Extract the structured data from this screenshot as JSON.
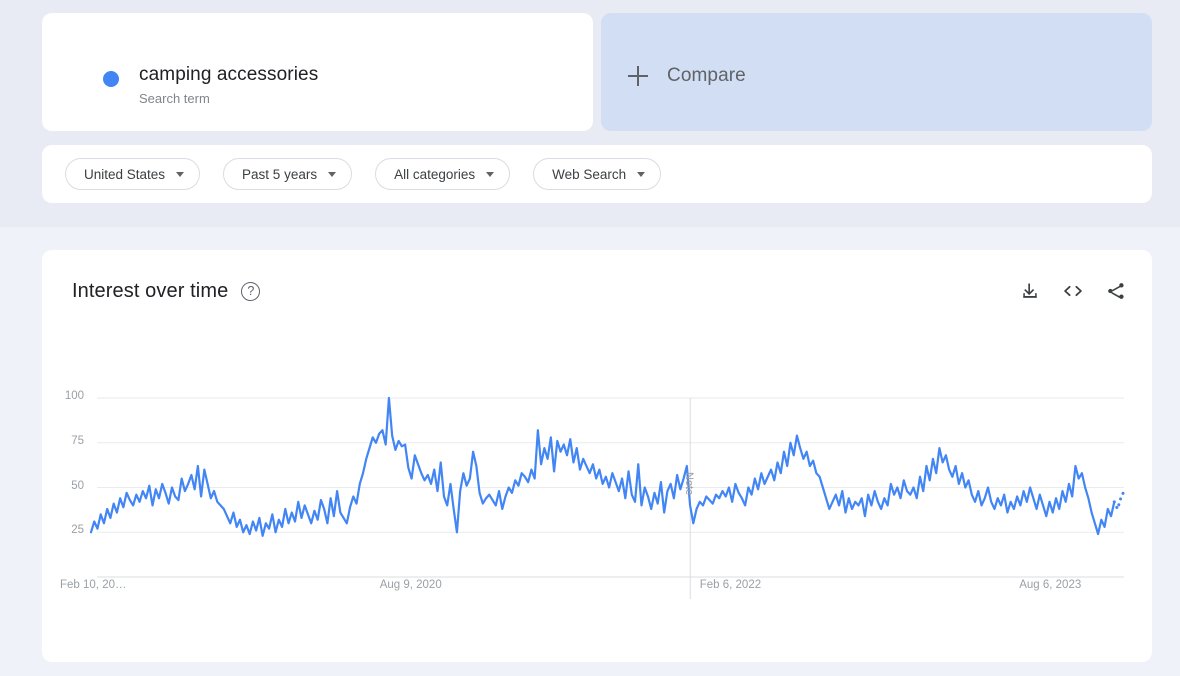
{
  "page": {
    "background_top": "#e8ebf4",
    "background_bottom": "#eff2f9",
    "accent_color": "#4285f4"
  },
  "term_card": {
    "title": "camping accessories",
    "subtitle": "Search term",
    "dot_color": "#4285f4",
    "menu_icon": "kebab-menu-icon"
  },
  "compare_card": {
    "label": "Compare",
    "icon": "plus-icon"
  },
  "filters": [
    {
      "label": "United States",
      "icon": "chevron-down-icon"
    },
    {
      "label": "Past 5 years",
      "icon": "chevron-down-icon"
    },
    {
      "label": "All categories",
      "icon": "chevron-down-icon"
    },
    {
      "label": "Web Search",
      "icon": "chevron-down-icon"
    }
  ],
  "chart_card": {
    "title": "Interest over time",
    "help_icon": "help-circle-icon",
    "help_glyph": "?",
    "actions": [
      {
        "name": "download-icon",
        "title": "Download"
      },
      {
        "name": "embed-code-icon",
        "title": "Embed"
      },
      {
        "name": "share-icon",
        "title": "Share"
      }
    ]
  },
  "chart_data": {
    "type": "line",
    "title": "Interest over time",
    "xlabel": "",
    "ylabel": "",
    "ylim": [
      0,
      100
    ],
    "yticks": [
      25,
      50,
      75,
      100
    ],
    "grid": true,
    "legend": false,
    "line_color": "#4285f4",
    "xtick_labels": [
      "Feb 10, 20…",
      "Aug 9, 2020",
      "Feb 6, 2022",
      "Aug 6, 2023"
    ],
    "xtick_positions": [
      0,
      0.3095,
      0.619,
      0.9286
    ],
    "annotation": {
      "label": "Note",
      "x_fraction": 0.5801
    },
    "partial_data_tail": true,
    "series": [
      {
        "name": "camping accessories",
        "values": [
          25,
          31,
          27,
          35,
          30,
          38,
          33,
          41,
          36,
          44,
          39,
          47,
          43,
          40,
          46,
          42,
          48,
          44,
          51,
          40,
          49,
          44,
          52,
          47,
          41,
          50,
          45,
          43,
          55,
          48,
          52,
          57,
          49,
          62,
          45,
          60,
          52,
          44,
          48,
          42,
          40,
          38,
          34,
          30,
          36,
          28,
          32,
          25,
          29,
          24,
          31,
          26,
          33,
          23,
          30,
          27,
          35,
          25,
          32,
          28,
          38,
          30,
          36,
          31,
          42,
          33,
          40,
          35,
          30,
          37,
          32,
          43,
          38,
          30,
          44,
          34,
          48,
          36,
          33,
          30,
          39,
          45,
          41,
          52,
          58,
          66,
          72,
          78,
          75,
          80,
          82,
          74,
          100,
          79,
          71,
          76,
          73,
          74,
          61,
          55,
          68,
          63,
          58,
          54,
          57,
          52,
          60,
          48,
          64,
          45,
          40,
          52,
          38,
          25,
          48,
          58,
          51,
          55,
          70,
          62,
          47,
          41,
          44,
          46,
          43,
          40,
          48,
          38,
          45,
          50,
          47,
          54,
          51,
          58,
          56,
          53,
          60,
          55,
          82,
          63,
          72,
          66,
          78,
          59,
          76,
          70,
          74,
          68,
          77,
          64,
          72,
          60,
          66,
          62,
          58,
          63,
          55,
          60,
          52,
          56,
          50,
          58,
          53,
          48,
          55,
          44,
          59,
          46,
          42,
          63,
          40,
          50,
          45,
          38,
          47,
          41,
          53,
          36,
          48,
          52,
          44,
          57,
          49,
          55,
          62,
          40,
          30,
          38,
          42,
          40,
          45,
          43,
          41,
          46,
          44,
          48,
          45,
          50,
          42,
          52,
          47,
          44,
          40,
          50,
          46,
          55,
          49,
          58,
          52,
          56,
          60,
          54,
          64,
          58,
          70,
          62,
          75,
          68,
          79,
          72,
          66,
          70,
          62,
          65,
          58,
          56,
          50,
          44,
          38,
          42,
          46,
          40,
          48,
          36,
          44,
          38,
          42,
          40,
          44,
          34,
          46,
          40,
          48,
          42,
          38,
          44,
          40,
          52,
          46,
          50,
          44,
          54,
          48,
          46,
          50,
          44,
          56,
          48,
          62,
          54,
          66,
          58,
          72,
          64,
          68,
          60,
          56,
          62,
          52,
          58,
          50,
          54,
          46,
          42,
          48,
          40,
          44,
          50,
          42,
          38,
          44,
          40,
          46,
          36,
          42,
          38,
          45,
          40,
          48,
          42,
          50,
          44,
          38,
          46,
          40,
          34,
          42,
          36,
          44,
          38,
          48,
          42,
          52,
          45,
          62,
          55,
          58,
          50,
          44,
          36,
          30,
          24,
          32,
          28,
          38,
          34,
          42
        ]
      }
    ],
    "partial_values": [
      38,
      44,
      48
    ]
  }
}
